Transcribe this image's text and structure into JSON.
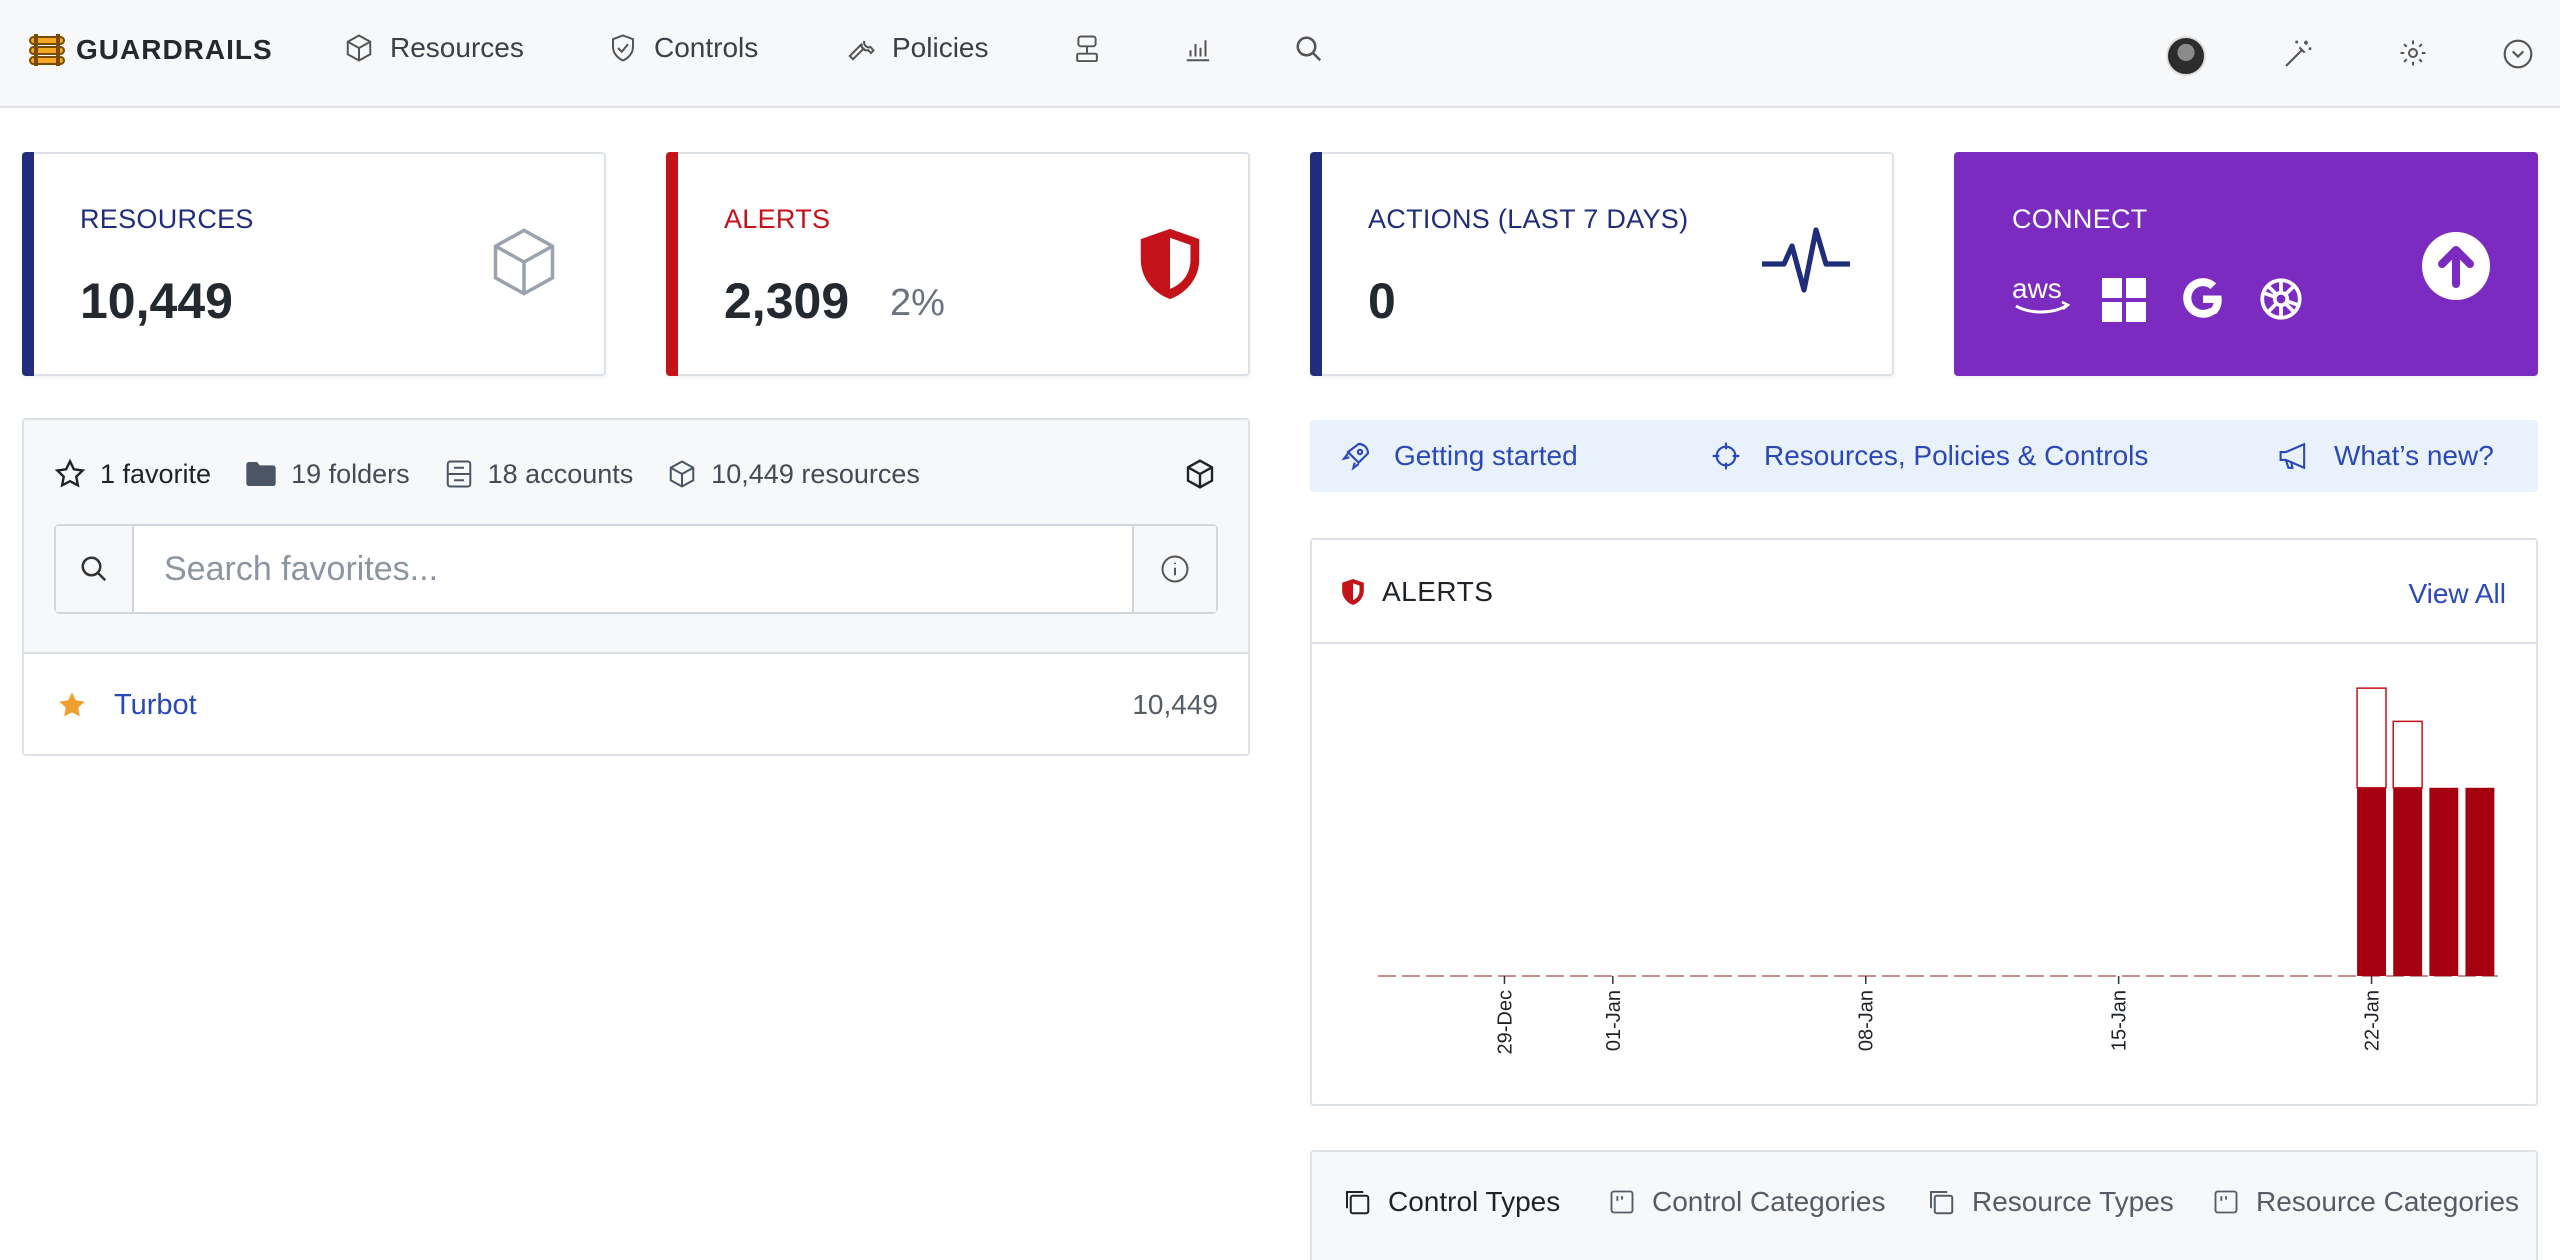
{
  "app": {
    "brand": "GUARDRAILS",
    "colors": {
      "accent_blue": "#1f2d7a",
      "alert_red": "#c4121a",
      "connect_purple": "#7b2bbf",
      "link_blue": "#2a48b8"
    }
  },
  "nav": {
    "items": [
      {
        "label": "Resources",
        "icon": "cube-icon"
      },
      {
        "label": "Controls",
        "icon": "shield-check-icon"
      },
      {
        "label": "Policies",
        "icon": "wrench-icon"
      }
    ],
    "icon_buttons": [
      "reports-icon",
      "bar-chart-icon",
      "search-icon"
    ],
    "right_icons": [
      "avatar",
      "magic-wand-icon",
      "gear-icon",
      "chevron-down-circle-icon"
    ]
  },
  "stats": {
    "resources": {
      "label": "RESOURCES",
      "value": "10,449",
      "icon": "cube-icon"
    },
    "alerts": {
      "label": "ALERTS",
      "value": "2,309",
      "percent": "2%",
      "icon": "shield-icon"
    },
    "actions": {
      "label": "ACTIONS (LAST 7 DAYS)",
      "value": "0",
      "icon": "pulse-icon"
    },
    "connect": {
      "label": "CONNECT",
      "providers": [
        "aws-icon",
        "windows-icon",
        "google-icon",
        "kubernetes-icon"
      ],
      "action_icon": "upload-arrow-icon"
    }
  },
  "favorites": {
    "summary": {
      "favorites": "1 favorite",
      "folders": "19 folders",
      "accounts": "18 accounts",
      "resources": "10,449 resources"
    },
    "search_placeholder": "Search favorites...",
    "items": [
      {
        "name": "Turbot",
        "count": "10,449"
      }
    ]
  },
  "quick_links": [
    {
      "label": "Getting started",
      "icon": "rocket-icon"
    },
    {
      "label": "Resources, Policies & Controls",
      "icon": "crosshair-icon"
    },
    {
      "label": "What’s new?",
      "icon": "megaphone-icon"
    }
  ],
  "alerts_panel": {
    "title": "ALERTS",
    "view_all": "View All"
  },
  "chart_data": {
    "type": "bar",
    "title": "ALERTS",
    "x_tick_labels": [
      "29-Dec",
      "01-Jan",
      "08-Jan",
      "15-Jan",
      "22-Jan"
    ],
    "start_date": "2023-12-26",
    "stack_series": [
      {
        "name": "",
        "style": "filled",
        "color": "#a5000f"
      },
      {
        "name": "",
        "style": "outline",
        "color": "#c4121a"
      }
    ],
    "days": [
      "26-Dec",
      "27-Dec",
      "28-Dec",
      "29-Dec",
      "30-Dec",
      "31-Dec",
      "01-Jan",
      "02-Jan",
      "03-Jan",
      "04-Jan",
      "05-Jan",
      "06-Jan",
      "07-Jan",
      "08-Jan",
      "09-Jan",
      "10-Jan",
      "11-Jan",
      "12-Jan",
      "13-Jan",
      "14-Jan",
      "15-Jan",
      "16-Jan",
      "17-Jan",
      "18-Jan",
      "19-Jan",
      "20-Jan",
      "21-Jan",
      "22-Jan",
      "23-Jan",
      "24-Jan",
      "25-Jan"
    ],
    "filled": [
      0,
      0,
      0,
      0,
      0,
      0,
      0,
      0,
      0,
      0,
      0,
      0,
      0,
      0,
      0,
      0,
      0,
      0,
      0,
      0,
      0,
      0,
      0,
      0,
      0,
      0,
      0,
      1700,
      1700,
      1700,
      1700
    ],
    "outline": [
      0,
      0,
      0,
      0,
      0,
      0,
      0,
      0,
      0,
      0,
      0,
      0,
      0,
      0,
      0,
      0,
      0,
      0,
      0,
      0,
      0,
      0,
      0,
      0,
      0,
      0,
      0,
      900,
      600,
      0,
      0
    ],
    "ylim": [
      0,
      2800
    ],
    "grid": false
  },
  "tabs": [
    {
      "label": "Control Types",
      "icon": "copy-icon",
      "active": true
    },
    {
      "label": "Control Categories",
      "icon": "category-icon",
      "active": false
    },
    {
      "label": "Resource Types",
      "icon": "copy-icon",
      "active": false
    },
    {
      "label": "Resource Categories",
      "icon": "category-icon",
      "active": false
    }
  ]
}
